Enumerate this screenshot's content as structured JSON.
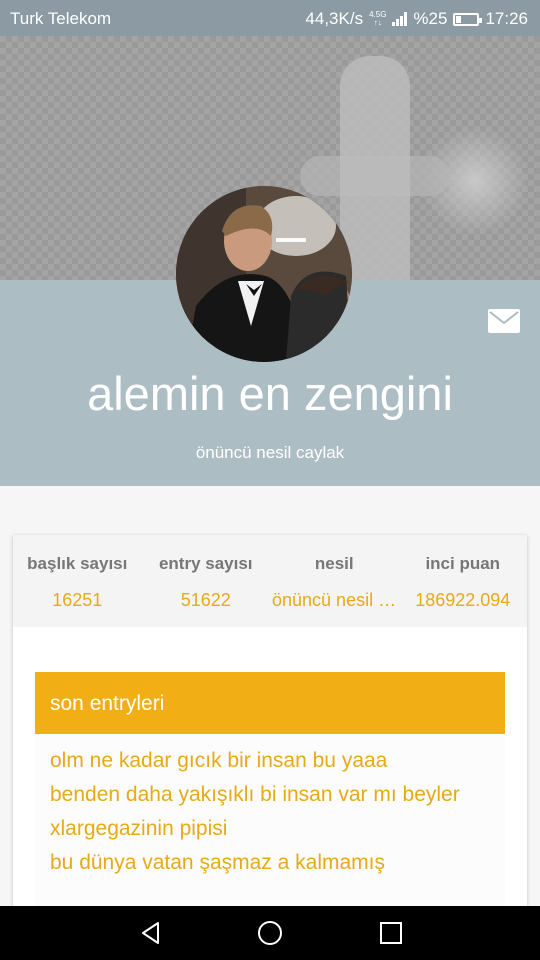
{
  "status": {
    "carrier": "Turk Telekom",
    "speed": "44,3K/s",
    "network_top": "4.5G",
    "network_bottom": "↑↓",
    "battery": "%25",
    "battery_level": 0.25,
    "time": "17:26"
  },
  "profile": {
    "username": "alemin en zengini",
    "title": "önüncü nesil caylak",
    "mail_icon": "envelope-icon"
  },
  "stats": [
    {
      "label": "başlık sayısı",
      "value": "16251"
    },
    {
      "label": "entry sayısı",
      "value": "51622"
    },
    {
      "label": "nesil",
      "value": "önüncü nesil caylak"
    },
    {
      "label": "inci puan",
      "value": "186922.094"
    }
  ],
  "recent": {
    "header": "son entryleri",
    "entries": [
      "olm ne kadar gıcık bir insan bu yaaa",
      "benden daha yakışıklı bi insan var mı beyler",
      "xlargegazinin pipisi",
      "bu dünya vatan şaşmaz a kalmamış"
    ]
  },
  "nav": {
    "back": "back-icon",
    "home": "home-icon",
    "recents": "recents-icon"
  },
  "colors": {
    "accent": "#f2ae15",
    "accent_text": "#e8a917",
    "header_band": "#adbdc4",
    "status_bar": "#8b9aa3"
  }
}
